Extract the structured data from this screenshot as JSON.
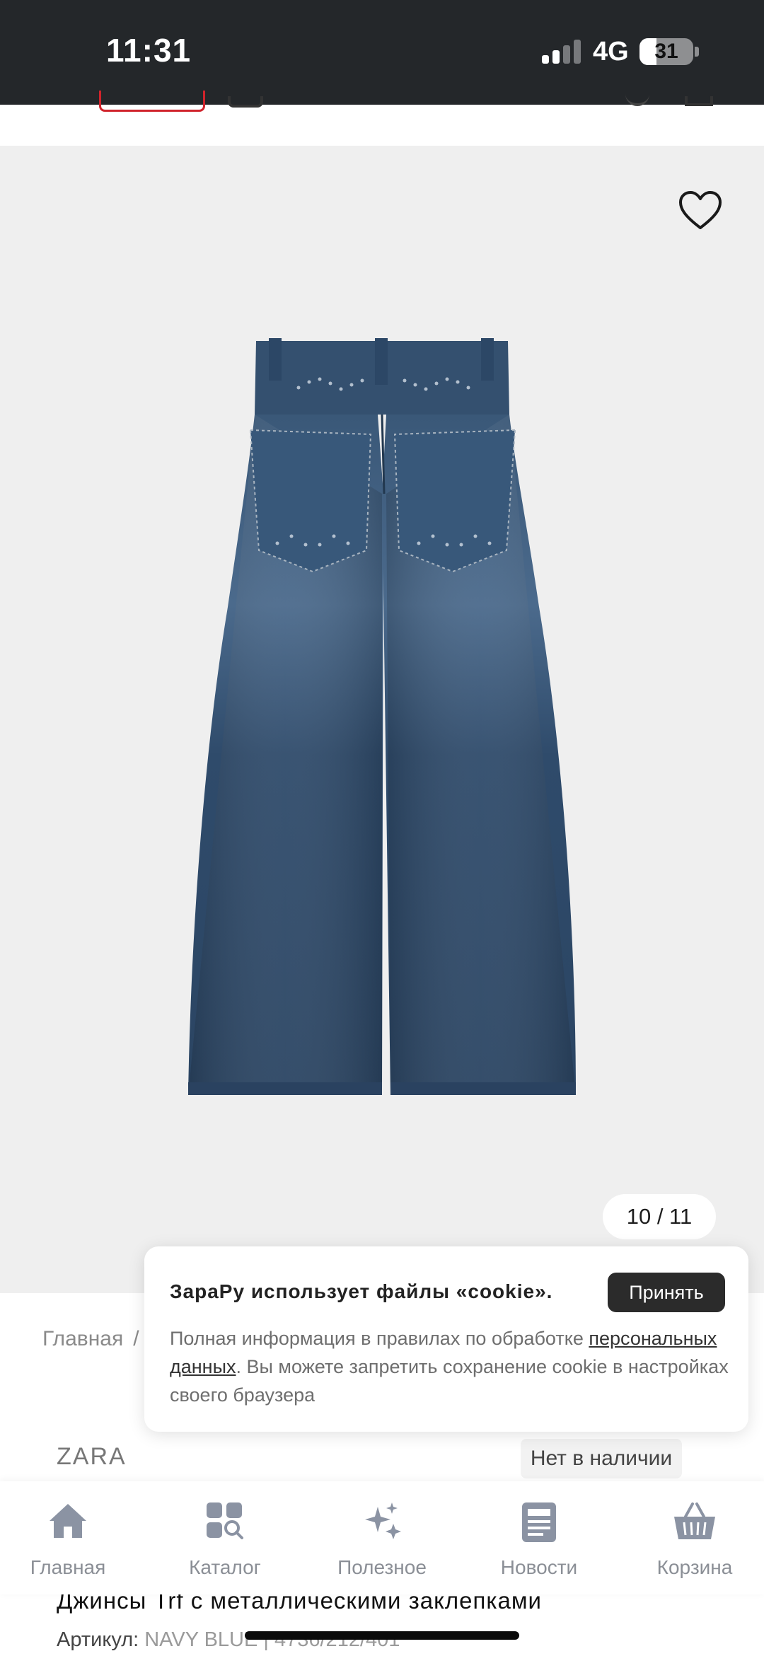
{
  "status_bar": {
    "time": "11:31",
    "network": "4G",
    "battery_percent": "31",
    "battery_level": 0.31
  },
  "gallery": {
    "counter": "10 / 11",
    "product_image_alt": "Джинсы"
  },
  "breadcrumb": {
    "home": "Главная",
    "separator": "/"
  },
  "product": {
    "brand": "ZARA",
    "stock_status": "Нет в наличии",
    "title": "Джинсы Trf с металлическими заклепками",
    "sku_label": "Артикул:",
    "sku_value": "NAVY BLUE | 4736/212/401"
  },
  "cookie_banner": {
    "title": "ЗараРу использует файлы «cookie».",
    "accept_label": "Принять",
    "text_before_link": "Полная информация в правилах по обработке ",
    "link_text": "персональных данных",
    "text_after_link": ". Вы можете запретить сохранение cookie в настройках своего браузера"
  },
  "bottom_nav": {
    "items": [
      {
        "label": "Главная",
        "icon": "home-icon"
      },
      {
        "label": "Каталог",
        "icon": "catalog-icon"
      },
      {
        "label": "Полезное",
        "icon": "sparkles-icon"
      },
      {
        "label": "Новости",
        "icon": "news-icon"
      },
      {
        "label": "Корзина",
        "icon": "basket-icon"
      }
    ]
  },
  "colors": {
    "status_bar_bg": "#24272a",
    "brand_red": "#d0232b",
    "nav_icon": "#8b93a3",
    "accept_button": "#2b2b2b",
    "gallery_bg": "#efefef"
  }
}
